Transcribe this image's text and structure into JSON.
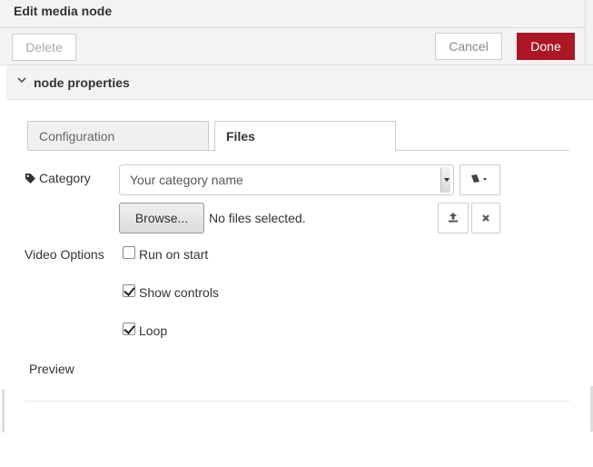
{
  "tray": {
    "title": "Edit media node",
    "delete_label": "Delete",
    "cancel_label": "Cancel",
    "done_label": "Done"
  },
  "section": {
    "title": "node properties",
    "chevron_icon": "chevron-down-icon"
  },
  "tabs": [
    {
      "label": "Configuration",
      "active": false
    },
    {
      "label": "Files",
      "active": true
    }
  ],
  "form": {
    "category_label": "Category",
    "category_icon": "tag-icon",
    "category_value": "Your category name",
    "book_icon": "book-icon",
    "browse_label": "Browse...",
    "file_status": "No files selected.",
    "upload_icon": "upload-icon",
    "clear_icon": "close-icon",
    "video_options_label": "Video Options",
    "options": [
      {
        "label": "Run on start",
        "checked": false
      },
      {
        "label": "Show controls",
        "checked": true
      },
      {
        "label": "Loop",
        "checked": true
      }
    ],
    "preview_label": "Preview"
  },
  "colors": {
    "done_button": "#ad1625",
    "header_background": "#f3f3f3"
  }
}
